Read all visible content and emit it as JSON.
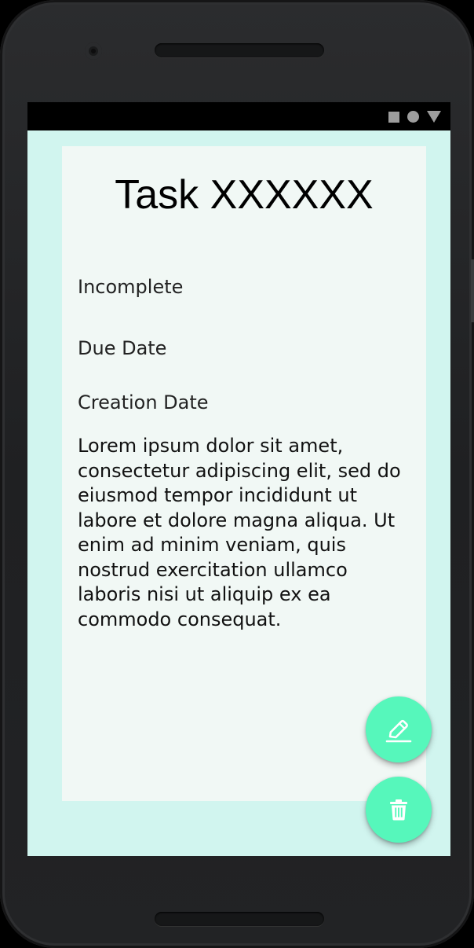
{
  "task": {
    "title": "Task XXXXXX",
    "status": "Incomplete",
    "due_date_label": "Due Date",
    "creation_date_label": "Creation Date",
    "description": "Lorem ipsum dolor sit amet, consectetur adipiscing elit, sed do eiusmod tempor incididunt ut labore et dolore magna aliqua. Ut enim ad minim veniam, quis nostrud exercitation ullamco laboris nisi ut aliquip ex ea commodo consequat."
  },
  "status_bar": {
    "icons": [
      "stop-square-icon",
      "circle-icon",
      "triangle-icon"
    ]
  },
  "actions": {
    "edit_icon": "edit-icon",
    "delete_icon": "trash-icon"
  },
  "colors": {
    "screen_bg": "#d1f5ef",
    "card_bg": "#f1f8f5",
    "fab": "#56f7bb",
    "fab_icon": "#ffffff"
  }
}
